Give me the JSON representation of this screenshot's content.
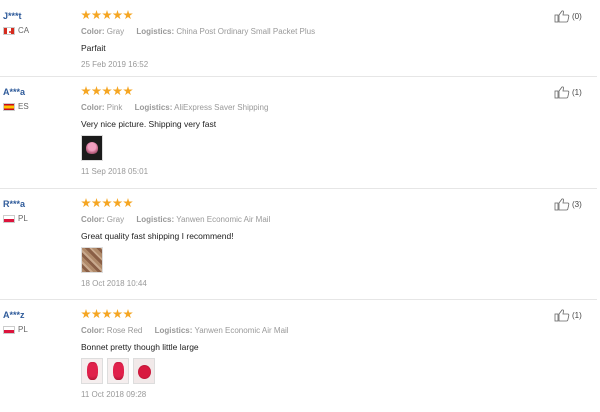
{
  "reviews": [
    {
      "user": "J***t",
      "country_code": "CA",
      "flag": "canada-flag",
      "rating": 5,
      "color_label": "Color:",
      "color_value": "Gray",
      "logistics_label": "Logistics:",
      "logistics_value": "China Post Ordinary Small Packet Plus",
      "comment": "Parfait",
      "photos": [],
      "date": "25 Feb 2019 16:52",
      "helpful": "(0)"
    },
    {
      "user": "A***a",
      "country_code": "ES",
      "flag": "spain-flag",
      "rating": 5,
      "color_label": "Color:",
      "color_value": "Pink",
      "logistics_label": "Logistics:",
      "logistics_value": "AliExpress Saver Shipping",
      "comment": "Very nice picture. Shipping very fast",
      "photos": [
        "review-photo-bonnet-pink-dark"
      ],
      "date": "11 Sep 2018 05:01",
      "helpful": "(1)"
    },
    {
      "user": "R***a",
      "country_code": "PL",
      "flag": "poland-flag",
      "rating": 5,
      "color_label": "Color:",
      "color_value": "Gray",
      "logistics_label": "Logistics:",
      "logistics_value": "Yanwen Economic Air Mail",
      "comment": "Great quality fast shipping I recommend!",
      "photos": [
        "review-photo-patterned-fabric"
      ],
      "date": "18 Oct 2018 10:44",
      "helpful": "(3)"
    },
    {
      "user": "A***z",
      "country_code": "PL",
      "flag": "poland-flag",
      "rating": 5,
      "color_label": "Color:",
      "color_value": "Rose Red",
      "logistics_label": "Logistics:",
      "logistics_value": "Yanwen Economic Air Mail",
      "comment": "Bonnet pretty though little large",
      "photos": [
        "review-photo-red-1",
        "review-photo-red-2",
        "review-photo-red-3"
      ],
      "date": "11 Oct 2018 09:28",
      "helpful": "(1)"
    }
  ],
  "colors": {
    "username": "#2f5b9a",
    "star": "#f5a623",
    "meta_text": "#999999",
    "divider": "#e6e6e6"
  },
  "icons": {
    "star": "star-icon",
    "helpful": "thumbs-up-icon"
  }
}
